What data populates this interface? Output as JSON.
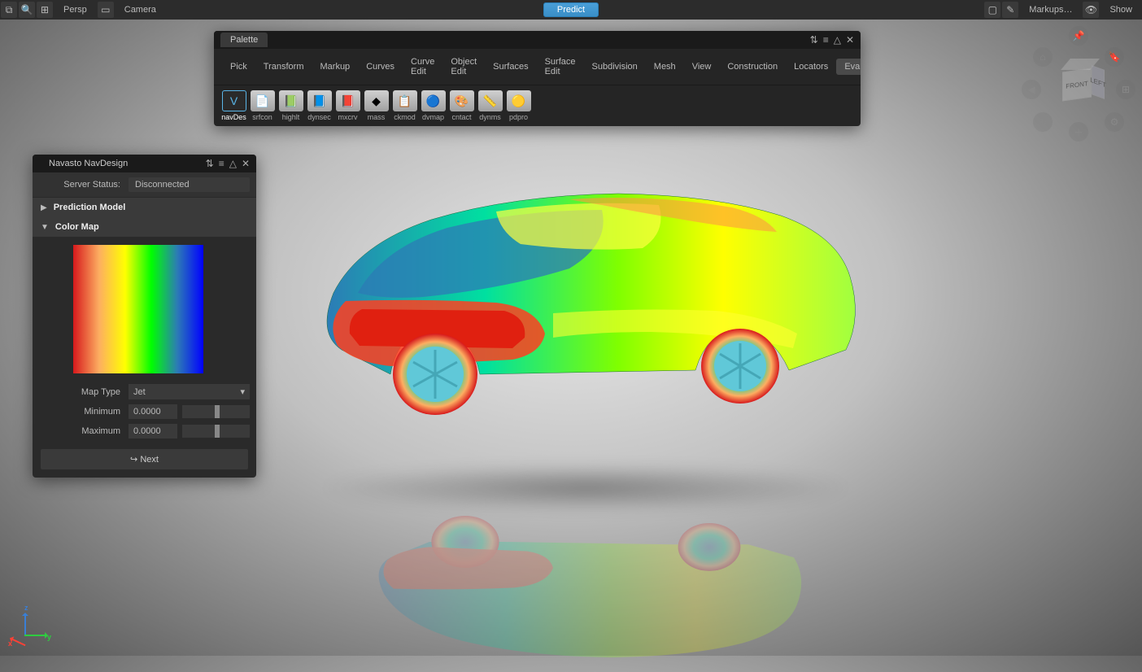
{
  "topbar": {
    "left": {
      "persp": "Persp",
      "camera": "Camera"
    },
    "center": {
      "predict": "Predict"
    },
    "right": {
      "markups": "Markups…",
      "show": "Show"
    }
  },
  "palette": {
    "title": "Palette",
    "tabs": [
      "Pick",
      "Transform",
      "Markup",
      "Curves",
      "Curve Edit",
      "Object Edit",
      "Surfaces",
      "Surface Edit",
      "Subdivision",
      "Mesh",
      "View",
      "Construction",
      "Locators",
      "Evaluate"
    ],
    "active_tab": "Evaluate",
    "tools": [
      {
        "label": "navDes",
        "active": true
      },
      {
        "label": "srfcon"
      },
      {
        "label": "highlt"
      },
      {
        "label": "dynsec"
      },
      {
        "label": "mxcrv"
      },
      {
        "label": "mass"
      },
      {
        "label": "ckmod"
      },
      {
        "label": "dvmap"
      },
      {
        "label": "cntact"
      },
      {
        "label": "dynms"
      },
      {
        "label": "pdpro"
      }
    ]
  },
  "navdesign": {
    "title": "Navasto NavDesign",
    "server_status_label": "Server Status:",
    "server_status_value": "Disconnected",
    "sections": {
      "prediction_model": "Prediction Model",
      "color_map": "Color Map"
    },
    "map_type_label": "Map Type",
    "map_type_value": "Jet",
    "min_label": "Minimum",
    "min_value": "0.0000",
    "max_label": "Maximum",
    "max_value": "0.0000",
    "next": "Next"
  },
  "viewcube": {
    "front": "FRONT",
    "left": "LEFT"
  },
  "axis": {
    "x": "x",
    "y": "y",
    "z": "z"
  }
}
